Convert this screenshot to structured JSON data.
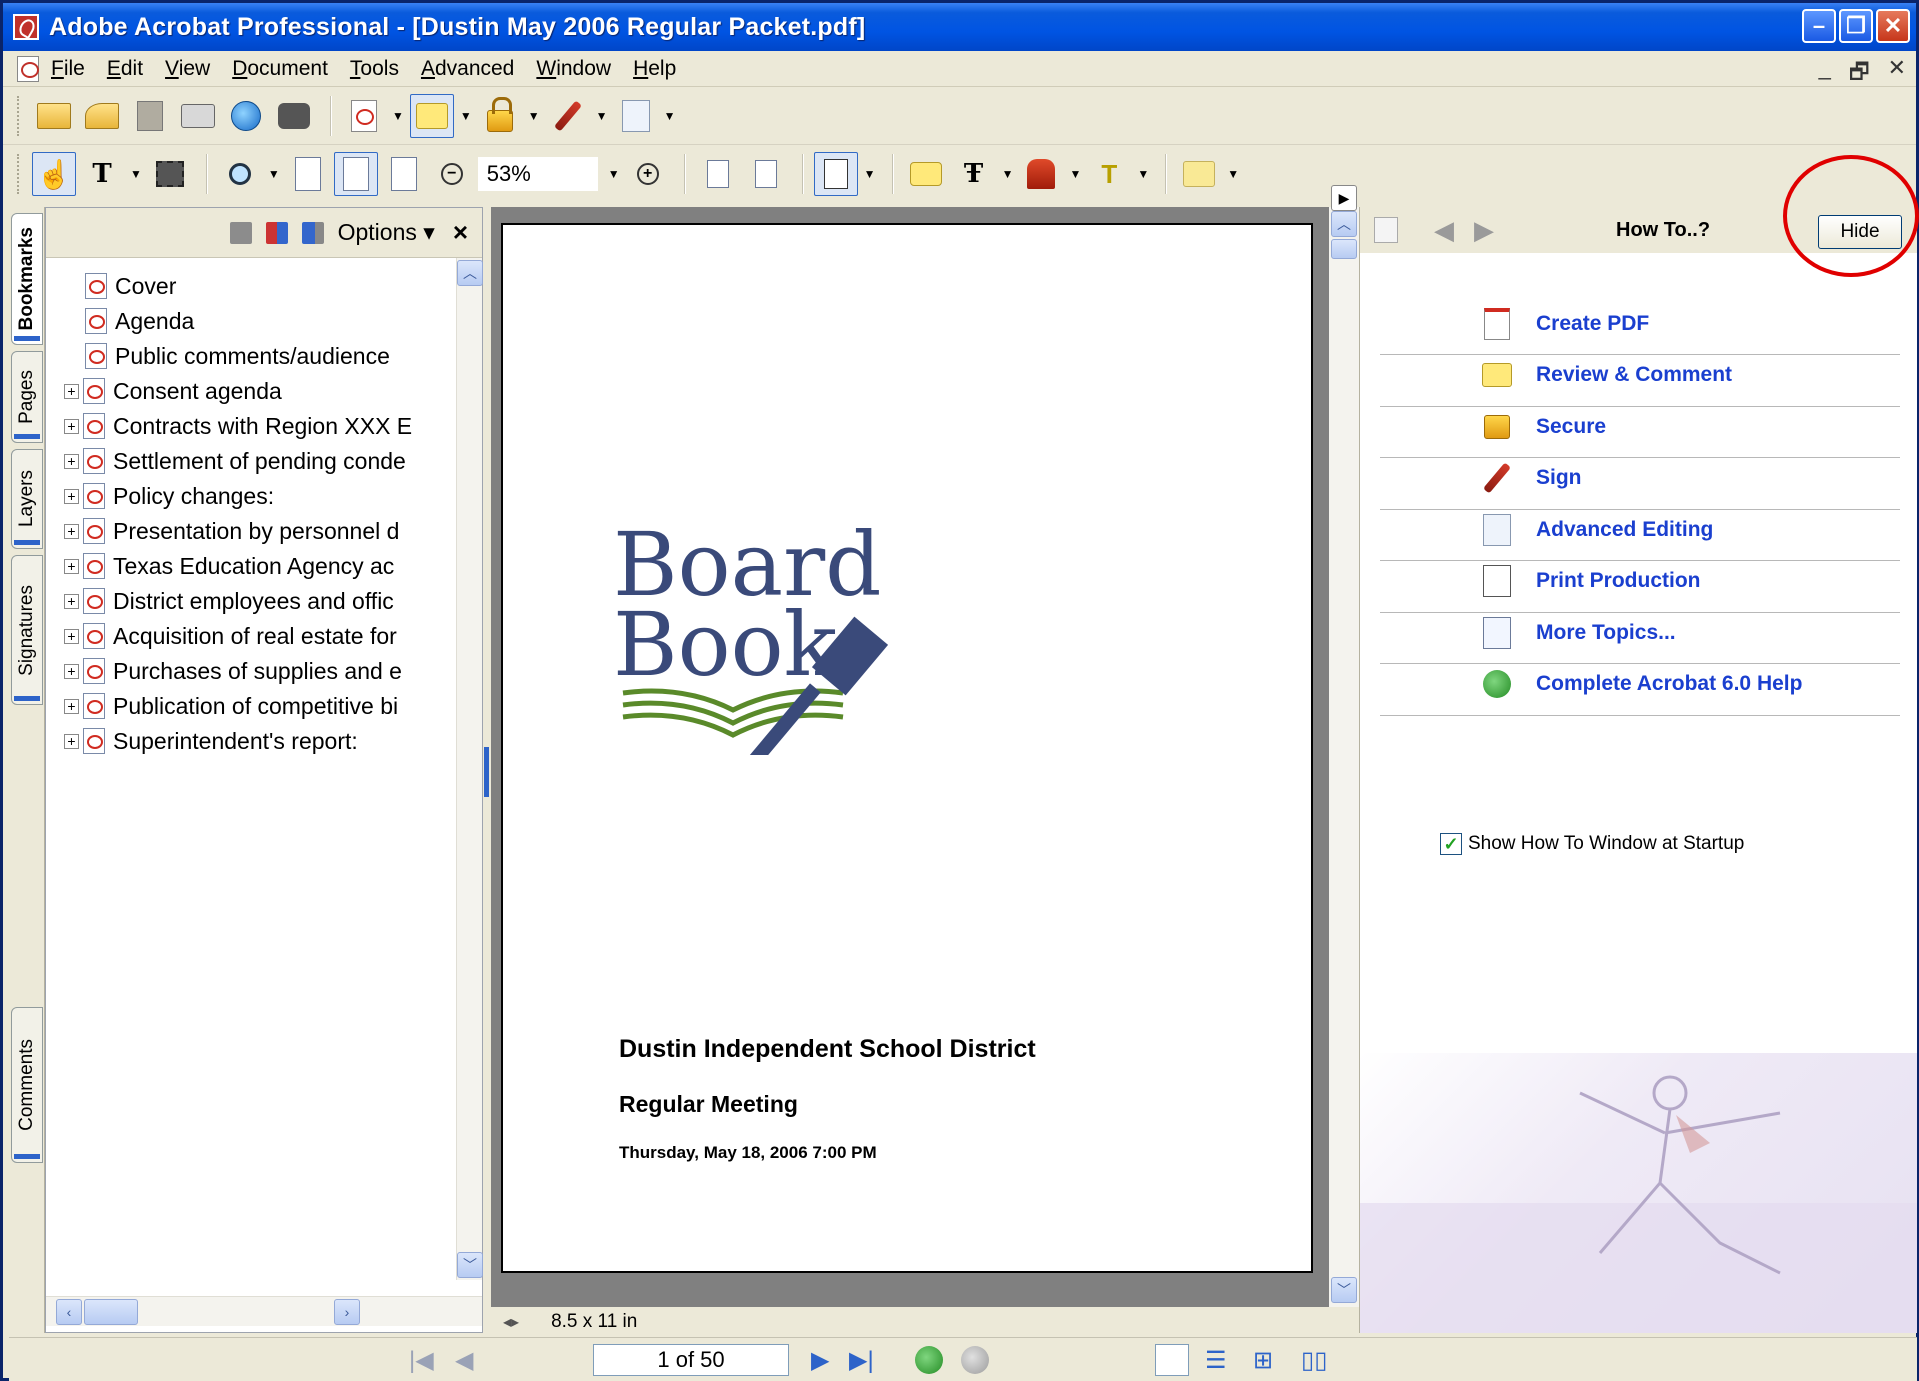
{
  "window": {
    "title": "Adobe Acrobat Professional - [Dustin May 2006 Regular Packet.pdf]",
    "controls": [
      "minimize",
      "restore",
      "close"
    ]
  },
  "menu": {
    "items": [
      "File",
      "Edit",
      "View",
      "Document",
      "Tools",
      "Advanced",
      "Window",
      "Help"
    ]
  },
  "toolbar": {
    "zoom": "53%",
    "icons": [
      "open-icon",
      "web-icon",
      "save-icon",
      "print-icon",
      "email-icon",
      "search-icon",
      "create-pdf-icon",
      "review-comment-icon",
      "secure-icon",
      "sign-icon",
      "advanced-editing-icon",
      "hand-icon",
      "select-text-icon",
      "snapshot-icon",
      "zoom-in-icon",
      "actual-size-icon",
      "fit-page-icon",
      "fit-width-icon",
      "zoom-out-icon",
      "zoom-plus-icon",
      "rotate-icon",
      "rotate-ccw-icon",
      "how-to-icon",
      "note-icon",
      "text-edit-icon",
      "stamp-icon",
      "highlight-icon",
      "show-comments-icon"
    ]
  },
  "nav": {
    "options_label": "Options",
    "close_label": "×",
    "tabs": [
      "Bookmarks",
      "Pages",
      "Layers",
      "Signatures",
      "Comments"
    ],
    "bookmarks": [
      {
        "label": "Cover",
        "expandable": false
      },
      {
        "label": "Agenda",
        "expandable": false
      },
      {
        "label": "Public comments/audience",
        "expandable": false
      },
      {
        "label": "Consent agenda",
        "expandable": true
      },
      {
        "label": "Contracts with Region XXX E",
        "expandable": true
      },
      {
        "label": "Settlement of pending conde",
        "expandable": true
      },
      {
        "label": "Policy changes:",
        "expandable": true
      },
      {
        "label": "Presentation by personnel d",
        "expandable": true
      },
      {
        "label": "Texas Education Agency ac",
        "expandable": true
      },
      {
        "label": "District employees and offic",
        "expandable": true
      },
      {
        "label": "Acquisition of real estate for",
        "expandable": true
      },
      {
        "label": "Purchases of supplies and e",
        "expandable": true
      },
      {
        "label": "Publication of competitive bi",
        "expandable": true
      },
      {
        "label": "Superintendent's report:",
        "expandable": true
      }
    ]
  },
  "document": {
    "logo_line1": "Board",
    "logo_line2": "Book",
    "title": "Dustin Independent School District",
    "subtitle": "Regular Meeting",
    "date": "Thursday, May 18, 2006 7:00 PM",
    "page_size": "8.5 x 11 in"
  },
  "howto": {
    "title": "How To..?",
    "hide_label": "Hide",
    "topics": [
      {
        "label": "Create PDF",
        "icon": "create-pdf-icon"
      },
      {
        "label": "Review & Comment",
        "icon": "review-comment-icon"
      },
      {
        "label": "Secure",
        "icon": "lock-icon"
      },
      {
        "label": "Sign",
        "icon": "pen-icon"
      },
      {
        "label": "Advanced Editing",
        "icon": "advanced-editing-icon"
      },
      {
        "label": "Print Production",
        "icon": "print-production-icon"
      },
      {
        "label": "More Topics...",
        "icon": "more-topics-icon"
      },
      {
        "label": "Complete Acrobat 6.0 Help",
        "icon": "help-icon"
      }
    ],
    "startup_label": "Show How To Window at Startup",
    "startup_checked": true
  },
  "status": {
    "page_indicator": "1 of 50"
  },
  "colors": {
    "titlebar": "#0054e3",
    "link_blue": "#1a3fcf",
    "highlight_circle": "#e00000",
    "logo_blue": "#3a4a7a",
    "logo_green": "#5a8a2a"
  }
}
